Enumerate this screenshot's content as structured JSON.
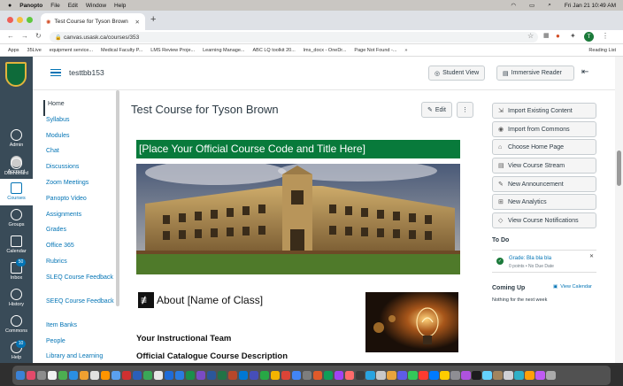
{
  "menubar": {
    "app": "Panopto",
    "items": [
      "File",
      "Edit",
      "Window",
      "Help"
    ],
    "clock": "Fri Jan 21  10:49 AM"
  },
  "browser": {
    "tab_title": "Test Course for Tyson Brown",
    "url": "canvas.usask.ca/courses/353",
    "profile_initial": "T",
    "bookmarks": [
      "Apps",
      "35Live",
      "equipment service...",
      "Medical Faculty P...",
      "LMS Review Proje...",
      "Learning Manage...",
      "ABC LQ toolkit 20...",
      "lms_docx - OneDr...",
      "Page Not Found -...",
      "»",
      "Reading List"
    ]
  },
  "global_nav": [
    {
      "label": "Account",
      "icon": "account-icon"
    },
    {
      "label": "Admin",
      "icon": "admin-icon"
    },
    {
      "label": "Dashboard",
      "icon": "dashboard-icon"
    },
    {
      "label": "Courses",
      "icon": "courses-icon",
      "active": true
    },
    {
      "label": "Groups",
      "icon": "groups-icon"
    },
    {
      "label": "Calendar",
      "icon": "calendar-icon"
    },
    {
      "label": "Inbox",
      "icon": "inbox-icon",
      "badge": "50"
    },
    {
      "label": "History",
      "icon": "history-icon"
    },
    {
      "label": "Commons",
      "icon": "commons-icon"
    },
    {
      "label": "Help",
      "icon": "help-icon",
      "badge": "10"
    }
  ],
  "header": {
    "breadcrumb": "testtbb153",
    "student_view": "Student View",
    "immersive_reader": "Immersive Reader"
  },
  "course_nav": [
    "Home",
    "Syllabus",
    "Modules",
    "Chat",
    "Discussions",
    "Zoom Meetings",
    "Panopto Video",
    "Assignments",
    "Grades",
    "Office 365",
    "Rubrics",
    "SLEQ Course Feedback",
    "SEEQ Course Feedback",
    "Item Banks",
    "People",
    "Library and Learning"
  ],
  "main": {
    "title": "Test Course for Tyson Brown",
    "edit": "Edit",
    "banner": "[Place Your Official Course Code and Title Here]",
    "about": "About [Name of Class]",
    "instructional_team": "Your Instructional Team",
    "catalogue": "Official Catalogue Course Description"
  },
  "sidebar": {
    "buttons": [
      "Import Existing Content",
      "Import from Commons",
      "Choose Home Page",
      "View Course Stream",
      "New Announcement",
      "New Analytics",
      "View Course Notifications"
    ],
    "todo_title": "To Do",
    "todo_item": "Grade: Bla bla bla",
    "todo_meta": "0 points • No Due Date",
    "coming_up": "Coming Up",
    "view_calendar": "View Calendar",
    "nothing": "Nothing for the next week"
  },
  "colors": {
    "accent": "#0374b5",
    "nav_bg": "#394b58",
    "banner": "#087a3b"
  }
}
